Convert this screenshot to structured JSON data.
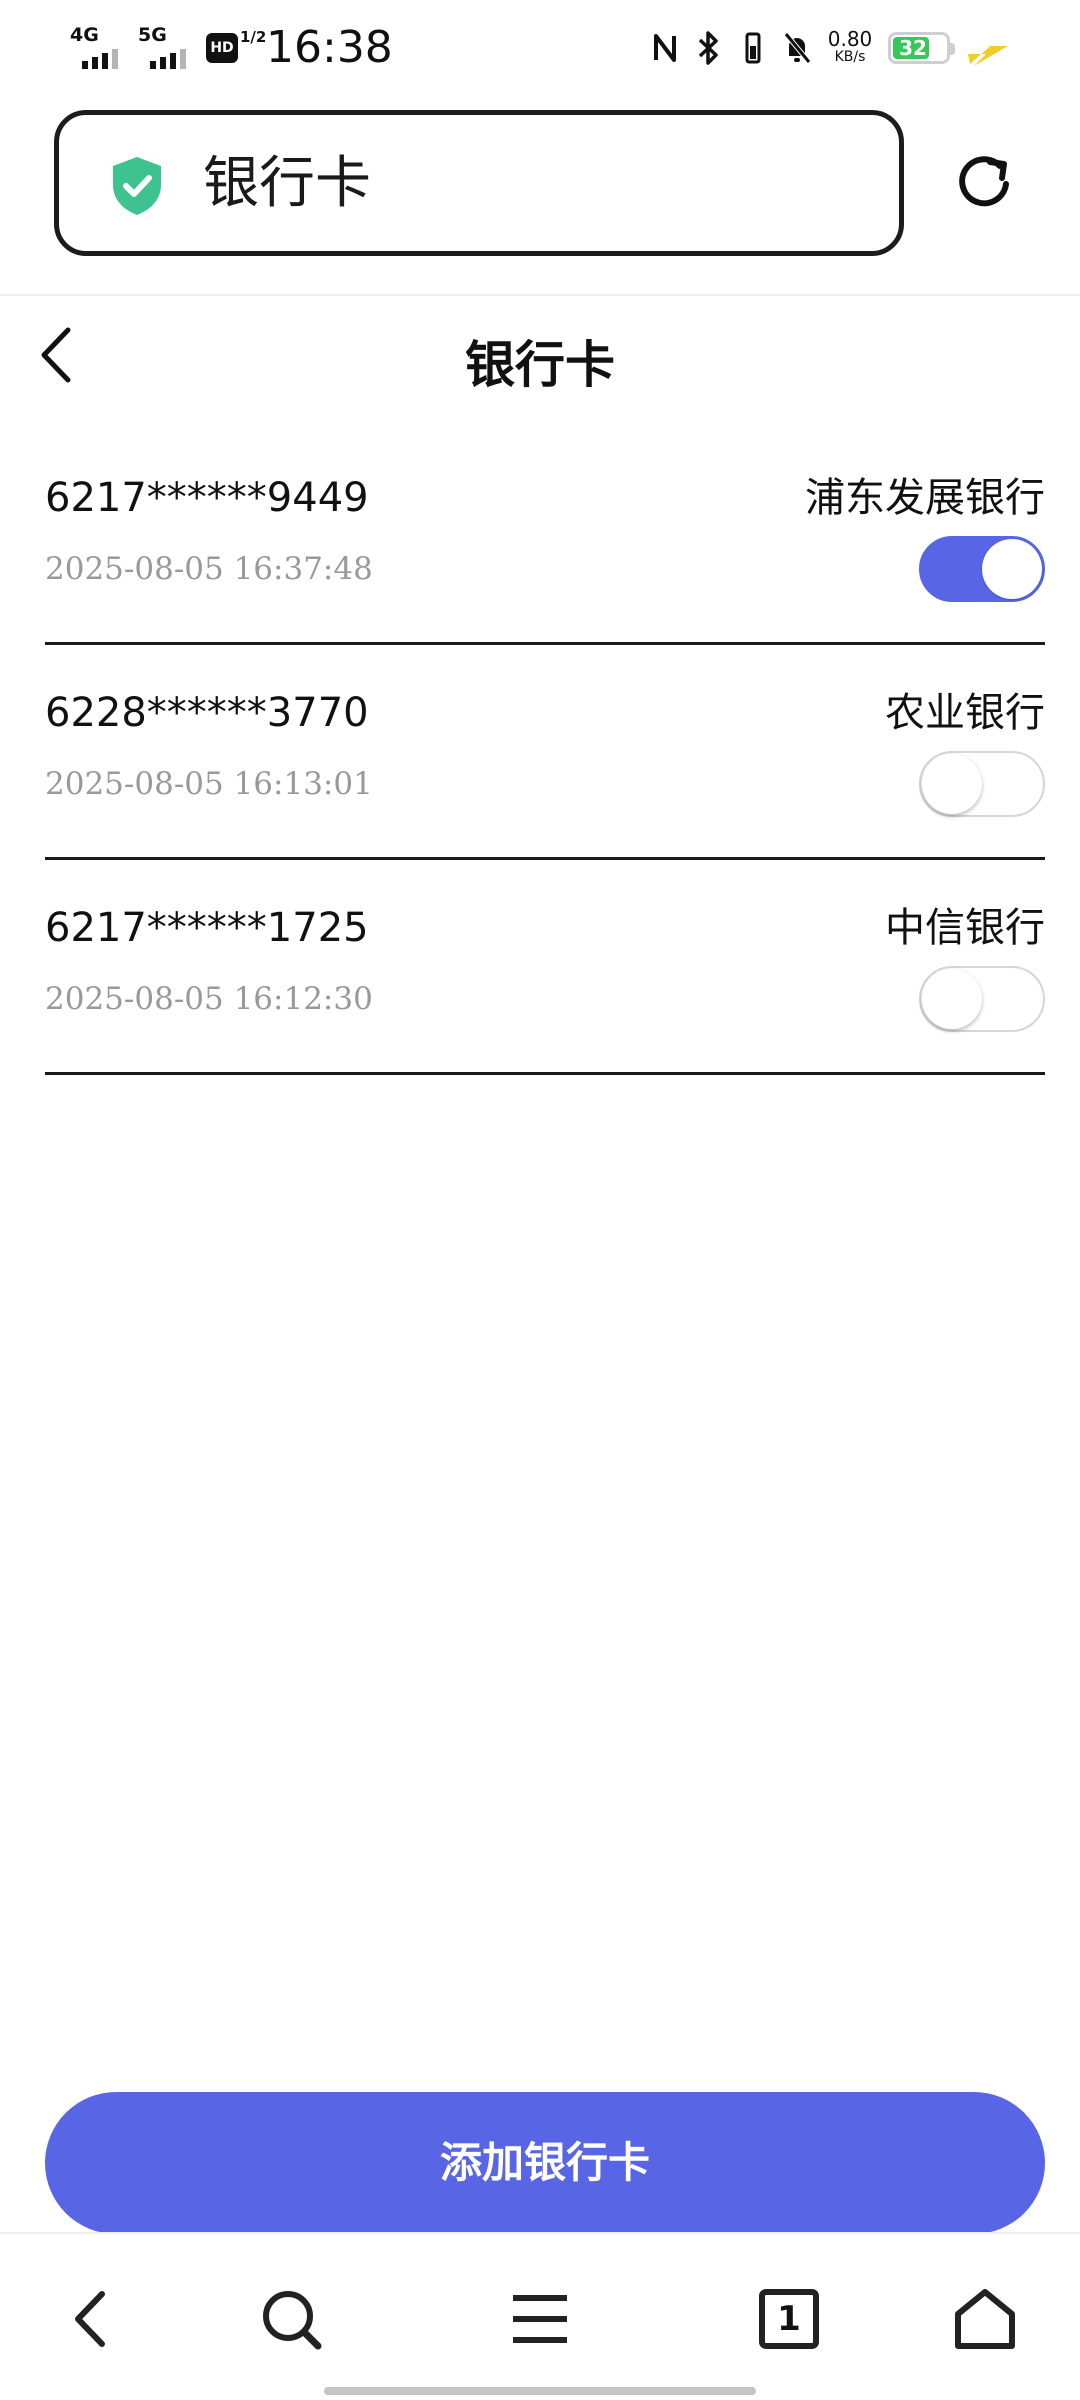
{
  "status_bar": {
    "net1": "4G",
    "net2": "5G",
    "hd_label": "HD",
    "hd_fraction": "1/2",
    "time": "16:38",
    "speed_value": "0.80",
    "speed_unit": "KB/s",
    "battery_level": "32",
    "battery_color": "#38c85a",
    "icons": [
      "nfc-icon",
      "bluetooth-icon",
      "vibrate-icon",
      "mute-bell-icon",
      "charging-icon"
    ]
  },
  "browser": {
    "address_title": "银行卡",
    "secure_color": "#3ec28f"
  },
  "header": {
    "title": "银行卡"
  },
  "cards": [
    {
      "number": "6217******9449",
      "date": "2025-08-05 16:37:48",
      "bank": "浦东发展银行",
      "enabled": true
    },
    {
      "number": "6228******3770",
      "date": "2025-08-05 16:13:01",
      "bank": "农业银行",
      "enabled": false
    },
    {
      "number": "6217******1725",
      "date": "2025-08-05 16:12:30",
      "bank": "中信银行",
      "enabled": false
    }
  ],
  "add_button": {
    "label": "添加银行卡"
  },
  "bottom_nav": {
    "tab_count": "1",
    "items": [
      "back-icon",
      "search-icon",
      "menu-icon",
      "tabs-icon",
      "home-icon"
    ]
  },
  "theme": {
    "accent": "#5866e6",
    "date_color": "#999999"
  }
}
